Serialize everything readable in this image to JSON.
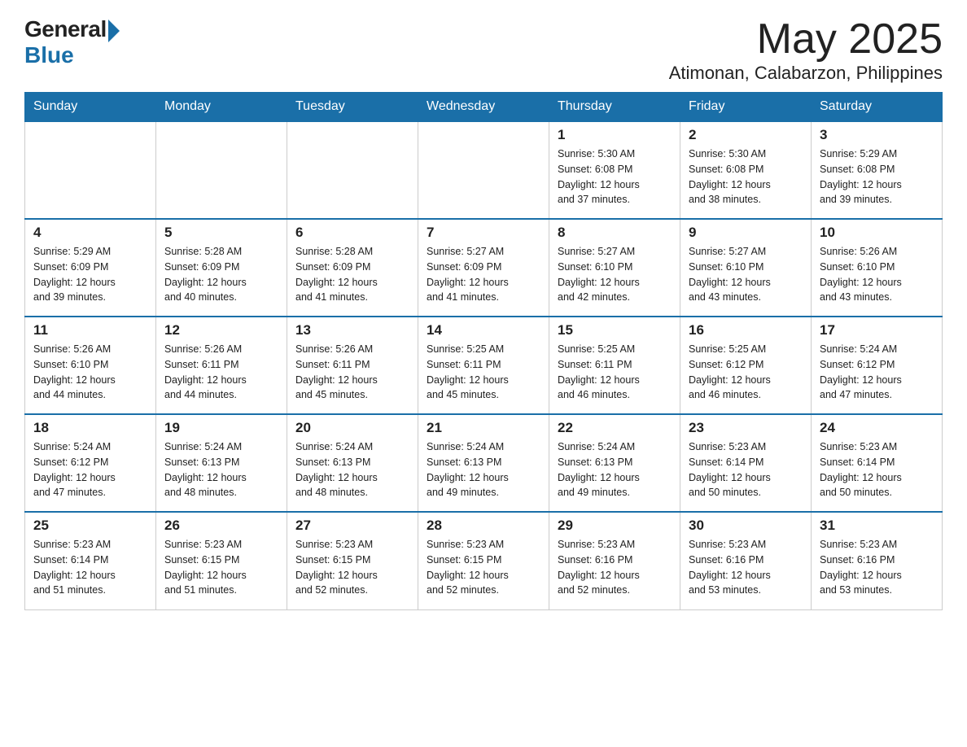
{
  "logo": {
    "general": "General",
    "blue": "Blue"
  },
  "header": {
    "month": "May 2025",
    "location": "Atimonan, Calabarzon, Philippines"
  },
  "weekdays": [
    "Sunday",
    "Monday",
    "Tuesday",
    "Wednesday",
    "Thursday",
    "Friday",
    "Saturday"
  ],
  "weeks": [
    [
      {
        "day": "",
        "info": ""
      },
      {
        "day": "",
        "info": ""
      },
      {
        "day": "",
        "info": ""
      },
      {
        "day": "",
        "info": ""
      },
      {
        "day": "1",
        "info": "Sunrise: 5:30 AM\nSunset: 6:08 PM\nDaylight: 12 hours\nand 37 minutes."
      },
      {
        "day": "2",
        "info": "Sunrise: 5:30 AM\nSunset: 6:08 PM\nDaylight: 12 hours\nand 38 minutes."
      },
      {
        "day": "3",
        "info": "Sunrise: 5:29 AM\nSunset: 6:08 PM\nDaylight: 12 hours\nand 39 minutes."
      }
    ],
    [
      {
        "day": "4",
        "info": "Sunrise: 5:29 AM\nSunset: 6:09 PM\nDaylight: 12 hours\nand 39 minutes."
      },
      {
        "day": "5",
        "info": "Sunrise: 5:28 AM\nSunset: 6:09 PM\nDaylight: 12 hours\nand 40 minutes."
      },
      {
        "day": "6",
        "info": "Sunrise: 5:28 AM\nSunset: 6:09 PM\nDaylight: 12 hours\nand 41 minutes."
      },
      {
        "day": "7",
        "info": "Sunrise: 5:27 AM\nSunset: 6:09 PM\nDaylight: 12 hours\nand 41 minutes."
      },
      {
        "day": "8",
        "info": "Sunrise: 5:27 AM\nSunset: 6:10 PM\nDaylight: 12 hours\nand 42 minutes."
      },
      {
        "day": "9",
        "info": "Sunrise: 5:27 AM\nSunset: 6:10 PM\nDaylight: 12 hours\nand 43 minutes."
      },
      {
        "day": "10",
        "info": "Sunrise: 5:26 AM\nSunset: 6:10 PM\nDaylight: 12 hours\nand 43 minutes."
      }
    ],
    [
      {
        "day": "11",
        "info": "Sunrise: 5:26 AM\nSunset: 6:10 PM\nDaylight: 12 hours\nand 44 minutes."
      },
      {
        "day": "12",
        "info": "Sunrise: 5:26 AM\nSunset: 6:11 PM\nDaylight: 12 hours\nand 44 minutes."
      },
      {
        "day": "13",
        "info": "Sunrise: 5:26 AM\nSunset: 6:11 PM\nDaylight: 12 hours\nand 45 minutes."
      },
      {
        "day": "14",
        "info": "Sunrise: 5:25 AM\nSunset: 6:11 PM\nDaylight: 12 hours\nand 45 minutes."
      },
      {
        "day": "15",
        "info": "Sunrise: 5:25 AM\nSunset: 6:11 PM\nDaylight: 12 hours\nand 46 minutes."
      },
      {
        "day": "16",
        "info": "Sunrise: 5:25 AM\nSunset: 6:12 PM\nDaylight: 12 hours\nand 46 minutes."
      },
      {
        "day": "17",
        "info": "Sunrise: 5:24 AM\nSunset: 6:12 PM\nDaylight: 12 hours\nand 47 minutes."
      }
    ],
    [
      {
        "day": "18",
        "info": "Sunrise: 5:24 AM\nSunset: 6:12 PM\nDaylight: 12 hours\nand 47 minutes."
      },
      {
        "day": "19",
        "info": "Sunrise: 5:24 AM\nSunset: 6:13 PM\nDaylight: 12 hours\nand 48 minutes."
      },
      {
        "day": "20",
        "info": "Sunrise: 5:24 AM\nSunset: 6:13 PM\nDaylight: 12 hours\nand 48 minutes."
      },
      {
        "day": "21",
        "info": "Sunrise: 5:24 AM\nSunset: 6:13 PM\nDaylight: 12 hours\nand 49 minutes."
      },
      {
        "day": "22",
        "info": "Sunrise: 5:24 AM\nSunset: 6:13 PM\nDaylight: 12 hours\nand 49 minutes."
      },
      {
        "day": "23",
        "info": "Sunrise: 5:23 AM\nSunset: 6:14 PM\nDaylight: 12 hours\nand 50 minutes."
      },
      {
        "day": "24",
        "info": "Sunrise: 5:23 AM\nSunset: 6:14 PM\nDaylight: 12 hours\nand 50 minutes."
      }
    ],
    [
      {
        "day": "25",
        "info": "Sunrise: 5:23 AM\nSunset: 6:14 PM\nDaylight: 12 hours\nand 51 minutes."
      },
      {
        "day": "26",
        "info": "Sunrise: 5:23 AM\nSunset: 6:15 PM\nDaylight: 12 hours\nand 51 minutes."
      },
      {
        "day": "27",
        "info": "Sunrise: 5:23 AM\nSunset: 6:15 PM\nDaylight: 12 hours\nand 52 minutes."
      },
      {
        "day": "28",
        "info": "Sunrise: 5:23 AM\nSunset: 6:15 PM\nDaylight: 12 hours\nand 52 minutes."
      },
      {
        "day": "29",
        "info": "Sunrise: 5:23 AM\nSunset: 6:16 PM\nDaylight: 12 hours\nand 52 minutes."
      },
      {
        "day": "30",
        "info": "Sunrise: 5:23 AM\nSunset: 6:16 PM\nDaylight: 12 hours\nand 53 minutes."
      },
      {
        "day": "31",
        "info": "Sunrise: 5:23 AM\nSunset: 6:16 PM\nDaylight: 12 hours\nand 53 minutes."
      }
    ]
  ]
}
